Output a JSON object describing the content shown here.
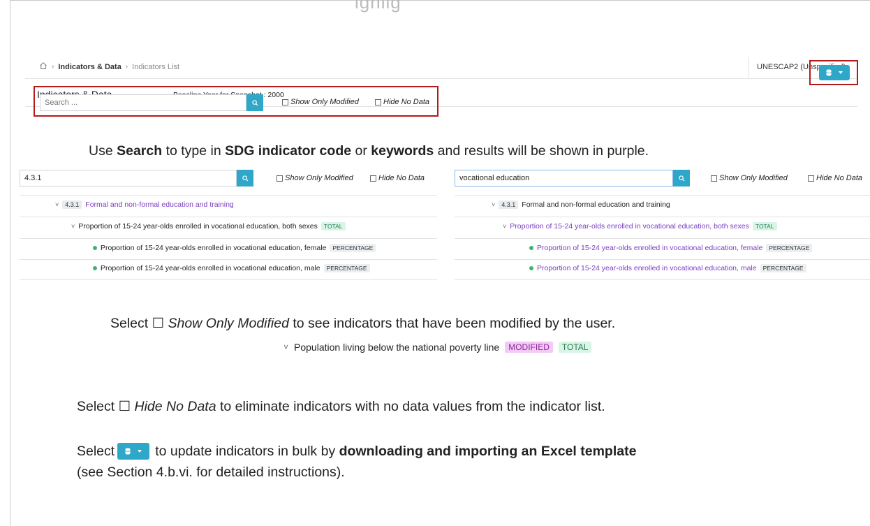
{
  "doc_heading_fragment": "ighlig",
  "app": {
    "breadcrumbs": [
      "Indicators & Data",
      "Indicators List"
    ],
    "user": "UNESCAP2 (Unspecified)",
    "title": "Indicators & Data",
    "baseline_label": "Baseline Year for Snapshot : 2000",
    "search_placeholder": "Search ...",
    "show_only_modified": "Show Only Modified",
    "hide_no_data": "Hide No Data"
  },
  "text": {
    "search_line": {
      "p1": "Use ",
      "b1": "Search",
      "p2": " to type in ",
      "b2": "SDG indicator code",
      "p3": " or ",
      "b3": "keywords",
      "p4": " and results will be shown in purple."
    },
    "modified_line": {
      "p1": "Select ☐ ",
      "i1": "Show Only Modified",
      "p2": " to see indicators that have been modified by the user."
    },
    "hide_line": {
      "p1": "Select ☐ ",
      "i1": "Hide No Data",
      "p2": " to eliminate indicators with no data values from the indicator list."
    },
    "bulk_line": {
      "p1": "Select ",
      "p2": " to update indicators in bulk by ",
      "b1": "downloading and importing an Excel template",
      "p3": "(see Section 4.b.vi. for detailed instructions)."
    }
  },
  "left_panel": {
    "search_value": "4.3.1",
    "code": "4.3.1",
    "group_label": "Formal and non-formal education and training",
    "parent_label": "Proportion of 15-24 year-olds enrolled in vocational education, both sexes",
    "parent_tag": "TOTAL",
    "children": [
      {
        "label": "Proportion of 15-24 year-olds enrolled in vocational education, female",
        "tag": "PERCENTAGE"
      },
      {
        "label": "Proportion of 15-24 year-olds enrolled in vocational education, male",
        "tag": "PERCENTAGE"
      }
    ]
  },
  "right_panel": {
    "search_value": "vocational education",
    "code": "4.3.1",
    "group_label": "Formal and non-formal education and training",
    "parent_label": "Proportion of 15-24 year-olds enrolled in vocational education, both sexes",
    "parent_tag": "TOTAL",
    "children": [
      {
        "label": "Proportion of 15-24 year-olds enrolled in vocational education, female",
        "tag": "PERCENTAGE"
      },
      {
        "label": "Proportion of 15-24 year-olds enrolled in vocational education, male",
        "tag": "PERCENTAGE"
      }
    ]
  },
  "modified_example": {
    "label": "Population living below the national poverty line",
    "tag_modified": "MODIFIED",
    "tag_total": "TOTAL"
  },
  "colors": {
    "accent": "#2ea7c9",
    "highlight_purple": "#7b3fc4",
    "callout_red": "#b41a1a"
  },
  "icons": [
    "home-icon",
    "search-icon",
    "database-icon",
    "caret-down-icon",
    "chevron-down-icon"
  ]
}
